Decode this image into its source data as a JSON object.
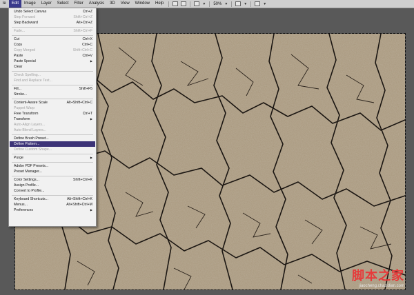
{
  "menubar": {
    "items": [
      "le",
      "Edit",
      "Image",
      "Layer",
      "Select",
      "Filter",
      "Analysis",
      "3D",
      "View",
      "Window",
      "Help"
    ],
    "zoom": "50%"
  },
  "edit_menu": {
    "items": [
      {
        "label": "Undo Select Canvas",
        "shortcut": "Ctrl+Z",
        "state": "enabled"
      },
      {
        "label": "Step Forward",
        "shortcut": "Shift+Ctrl+Z",
        "state": "disabled"
      },
      {
        "label": "Step Backward",
        "shortcut": "Alt+Ctrl+Z",
        "state": "enabled"
      },
      {
        "label": "Fade...",
        "shortcut": "Shift+Ctrl+F",
        "state": "disabled"
      },
      {
        "label": "Cut",
        "shortcut": "Ctrl+X",
        "state": "enabled"
      },
      {
        "label": "Copy",
        "shortcut": "Ctrl+C",
        "state": "enabled"
      },
      {
        "label": "Copy Merged",
        "shortcut": "Shift+Ctrl+C",
        "state": "disabled"
      },
      {
        "label": "Paste",
        "shortcut": "Ctrl+V",
        "state": "enabled"
      },
      {
        "label": "Paste Special",
        "shortcut": "",
        "state": "submenu"
      },
      {
        "label": "Clear",
        "shortcut": "",
        "state": "enabled"
      },
      {
        "label": "Check Spelling...",
        "shortcut": "",
        "state": "disabled"
      },
      {
        "label": "Find and Replace Text...",
        "shortcut": "",
        "state": "disabled"
      },
      {
        "label": "Fill...",
        "shortcut": "Shift+F5",
        "state": "enabled"
      },
      {
        "label": "Stroke...",
        "shortcut": "",
        "state": "enabled"
      },
      {
        "label": "Content-Aware Scale",
        "shortcut": "Alt+Shift+Ctrl+C",
        "state": "enabled"
      },
      {
        "label": "Puppet Warp",
        "shortcut": "",
        "state": "disabled"
      },
      {
        "label": "Free Transform",
        "shortcut": "Ctrl+T",
        "state": "enabled"
      },
      {
        "label": "Transform",
        "shortcut": "",
        "state": "submenu"
      },
      {
        "label": "Auto-Align Layers...",
        "shortcut": "",
        "state": "disabled"
      },
      {
        "label": "Auto-Blend Layers...",
        "shortcut": "",
        "state": "disabled"
      },
      {
        "label": "Define Brush Preset...",
        "shortcut": "",
        "state": "enabled"
      },
      {
        "label": "Define Pattern...",
        "shortcut": "",
        "state": "highlight"
      },
      {
        "label": "Define Custom Shape...",
        "shortcut": "",
        "state": "disabled"
      },
      {
        "label": "Purge",
        "shortcut": "",
        "state": "submenu"
      },
      {
        "label": "Adobe PDF Presets...",
        "shortcut": "",
        "state": "enabled"
      },
      {
        "label": "Preset Manager...",
        "shortcut": "",
        "state": "enabled"
      },
      {
        "label": "Color Settings...",
        "shortcut": "Shift+Ctrl+K",
        "state": "enabled"
      },
      {
        "label": "Assign Profile...",
        "shortcut": "",
        "state": "enabled"
      },
      {
        "label": "Convert to Profile...",
        "shortcut": "",
        "state": "enabled"
      },
      {
        "label": "Keyboard Shortcuts...",
        "shortcut": "Alt+Shift+Ctrl+K",
        "state": "enabled"
      },
      {
        "label": "Menus...",
        "shortcut": "Alt+Shift+Ctrl+M",
        "state": "enabled"
      },
      {
        "label": "Preferences",
        "shortcut": "",
        "state": "submenu"
      }
    ]
  },
  "watermark": {
    "title": "脚本之家",
    "url": "jiaocheng.chazidian.com"
  },
  "colors": {
    "highlight": "#3c3377",
    "canvas_texture": "#a4937a",
    "watermark": "#e63b3b"
  },
  "icons": [
    "arrow-icon",
    "layout-icon",
    "screen-mode-icon",
    "dropdown-icon"
  ]
}
